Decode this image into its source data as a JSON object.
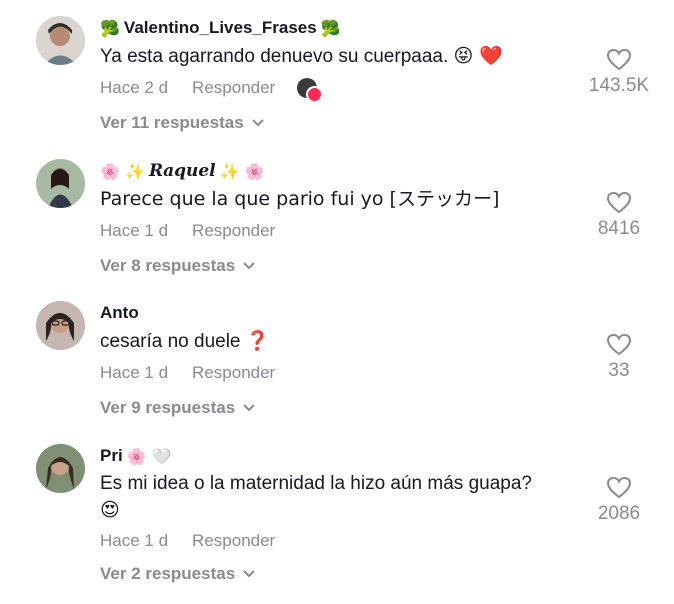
{
  "colors": {
    "text": "#161823",
    "muted": "#8a8b91",
    "like_accent": "#fe2c55"
  },
  "comments": [
    {
      "username": "Valentino_Lives_Frases",
      "prefix_emoji": "🥦",
      "suffix_emoji": "🥦",
      "text": "Ya esta agarrando denuevo su cuerpaaa.",
      "text_emoji": "😝 ❤️",
      "time": "Hace 2 d",
      "reply_label": "Responder",
      "replies_label": "Ver 11 respuestas",
      "likes": "143.5K",
      "liked_by_creator": true
    },
    {
      "username": "𝑹𝒂𝒒𝒖𝒆𝒍",
      "prefix_emoji": "🌸 ✨",
      "suffix_emoji": "✨ 🌸",
      "text": "Parece que la que pario fui yo [ステッカー]",
      "text_emoji": "",
      "time": "Hace 1 d",
      "reply_label": "Responder",
      "replies_label": "Ver 8 respuestas",
      "likes": "8416",
      "liked_by_creator": false
    },
    {
      "username": "Anto",
      "prefix_emoji": "",
      "suffix_emoji": "",
      "text": "cesaría no duele",
      "text_emoji": "❓",
      "time": "Hace 1 d",
      "reply_label": "Responder",
      "replies_label": "Ver 9 respuestas",
      "likes": "33",
      "liked_by_creator": false
    },
    {
      "username": "Pri",
      "prefix_emoji": "",
      "suffix_emoji": "🌸 🤍",
      "text": "Es mi idea o la maternidad la hizo aún más guapa?",
      "text_line2": "😍",
      "time": "Hace 1 d",
      "reply_label": "Responder",
      "replies_label": "Ver 2 respuestas",
      "likes": "2086",
      "liked_by_creator": false
    }
  ]
}
